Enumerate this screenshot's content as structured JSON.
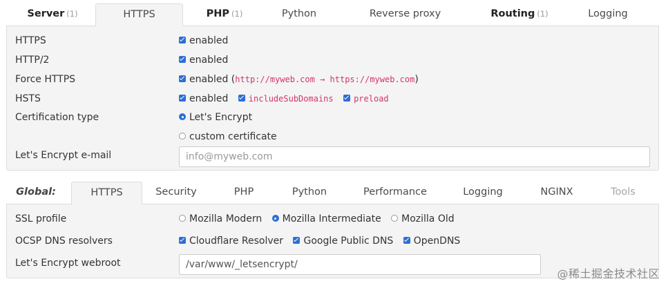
{
  "top_tabs": [
    {
      "label": "Server",
      "count": "(1)"
    },
    {
      "label": "HTTPS"
    },
    {
      "label": "PHP",
      "count": "(1)"
    },
    {
      "label": "Python"
    },
    {
      "label": "Reverse proxy"
    },
    {
      "label": "Routing",
      "count": "(1)"
    },
    {
      "label": "Logging"
    }
  ],
  "https_panel": {
    "https": {
      "label": "HTTPS",
      "value": "enabled"
    },
    "http2": {
      "label": "HTTP/2",
      "value": "enabled"
    },
    "force_https": {
      "label": "Force HTTPS",
      "value": "enabled",
      "paren_open": "(",
      "redirect": "http://myweb.com → https://myweb.com",
      "paren_close": ")"
    },
    "hsts": {
      "label": "HSTS",
      "value": "enabled",
      "option1": "includeSubDomains",
      "option2": "preload"
    },
    "cert_type": {
      "label": "Certification type",
      "option1": "Let's Encrypt",
      "option2": "custom certificate"
    },
    "le_email": {
      "label": "Let's Encrypt e-mail",
      "placeholder": "info@myweb.com"
    }
  },
  "global_tabs": {
    "label": "Global:",
    "items": [
      "HTTPS",
      "Security",
      "PHP",
      "Python",
      "Performance",
      "Logging",
      "NGINX",
      "Tools"
    ]
  },
  "global_panel": {
    "ssl_profile": {
      "label": "SSL profile",
      "options": [
        "Mozilla Modern",
        "Mozilla Intermediate",
        "Mozilla Old"
      ]
    },
    "ocsp": {
      "label": "OCSP DNS resolvers",
      "options": [
        "Cloudflare Resolver",
        "Google Public DNS",
        "OpenDNS"
      ]
    },
    "webroot": {
      "label": "Let's Encrypt webroot",
      "value": "/var/www/_letsencrypt/"
    }
  },
  "watermark": "@稀土掘金技术社区",
  "colors": {
    "accent": "#2a6fd6",
    "code": "#d6336c",
    "panel_bg": "#f4f4f4",
    "border": "#dcdcdc"
  }
}
